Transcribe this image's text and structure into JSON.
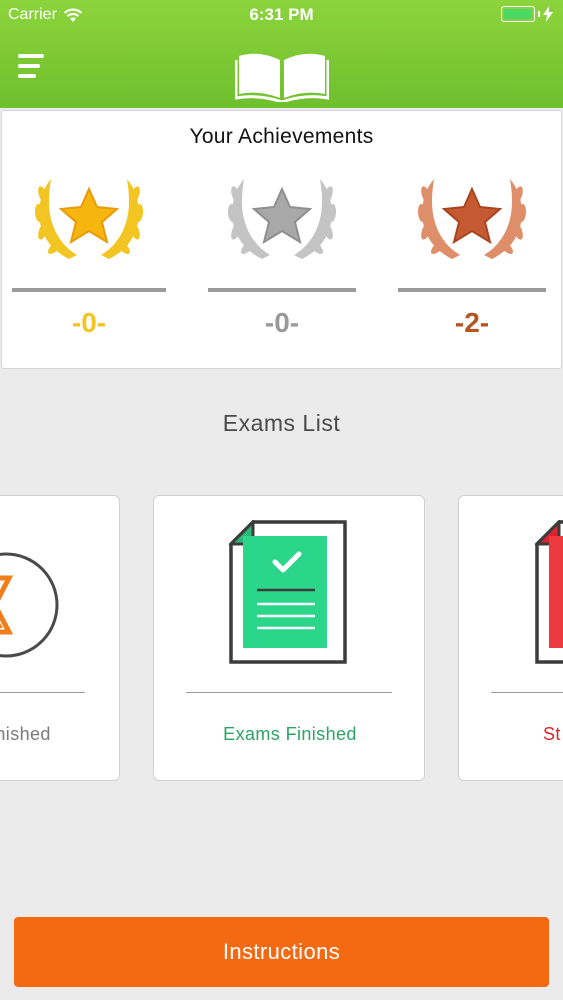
{
  "status_bar": {
    "carrier": "Carrier",
    "time": "6:31 PM"
  },
  "nav": {
    "menu_icon": "hamburger-menu-icon",
    "logo_icon": "open-book-icon"
  },
  "achievements": {
    "title": "Your Achievements",
    "medals": [
      {
        "name": "gold",
        "count": "-0-",
        "color": "#f2c522"
      },
      {
        "name": "silver",
        "count": "-0-",
        "color": "#9a9a9a"
      },
      {
        "name": "bronze",
        "count": "-2-",
        "color": "#b5541c"
      }
    ]
  },
  "exams": {
    "title": "Exams List",
    "cards": [
      {
        "label": "inished",
        "color": "#7a7a7a",
        "icon": "hourglass-icon"
      },
      {
        "label": "Exams Finished",
        "color": "#2aa363",
        "icon": "document-check-icon"
      },
      {
        "label": "St",
        "color": "#e0212b",
        "icon": "document-icon"
      }
    ]
  },
  "instructions_button": "Instructions",
  "colors": {
    "nav_green": "#7cc832",
    "button_orange": "#f36a12"
  }
}
